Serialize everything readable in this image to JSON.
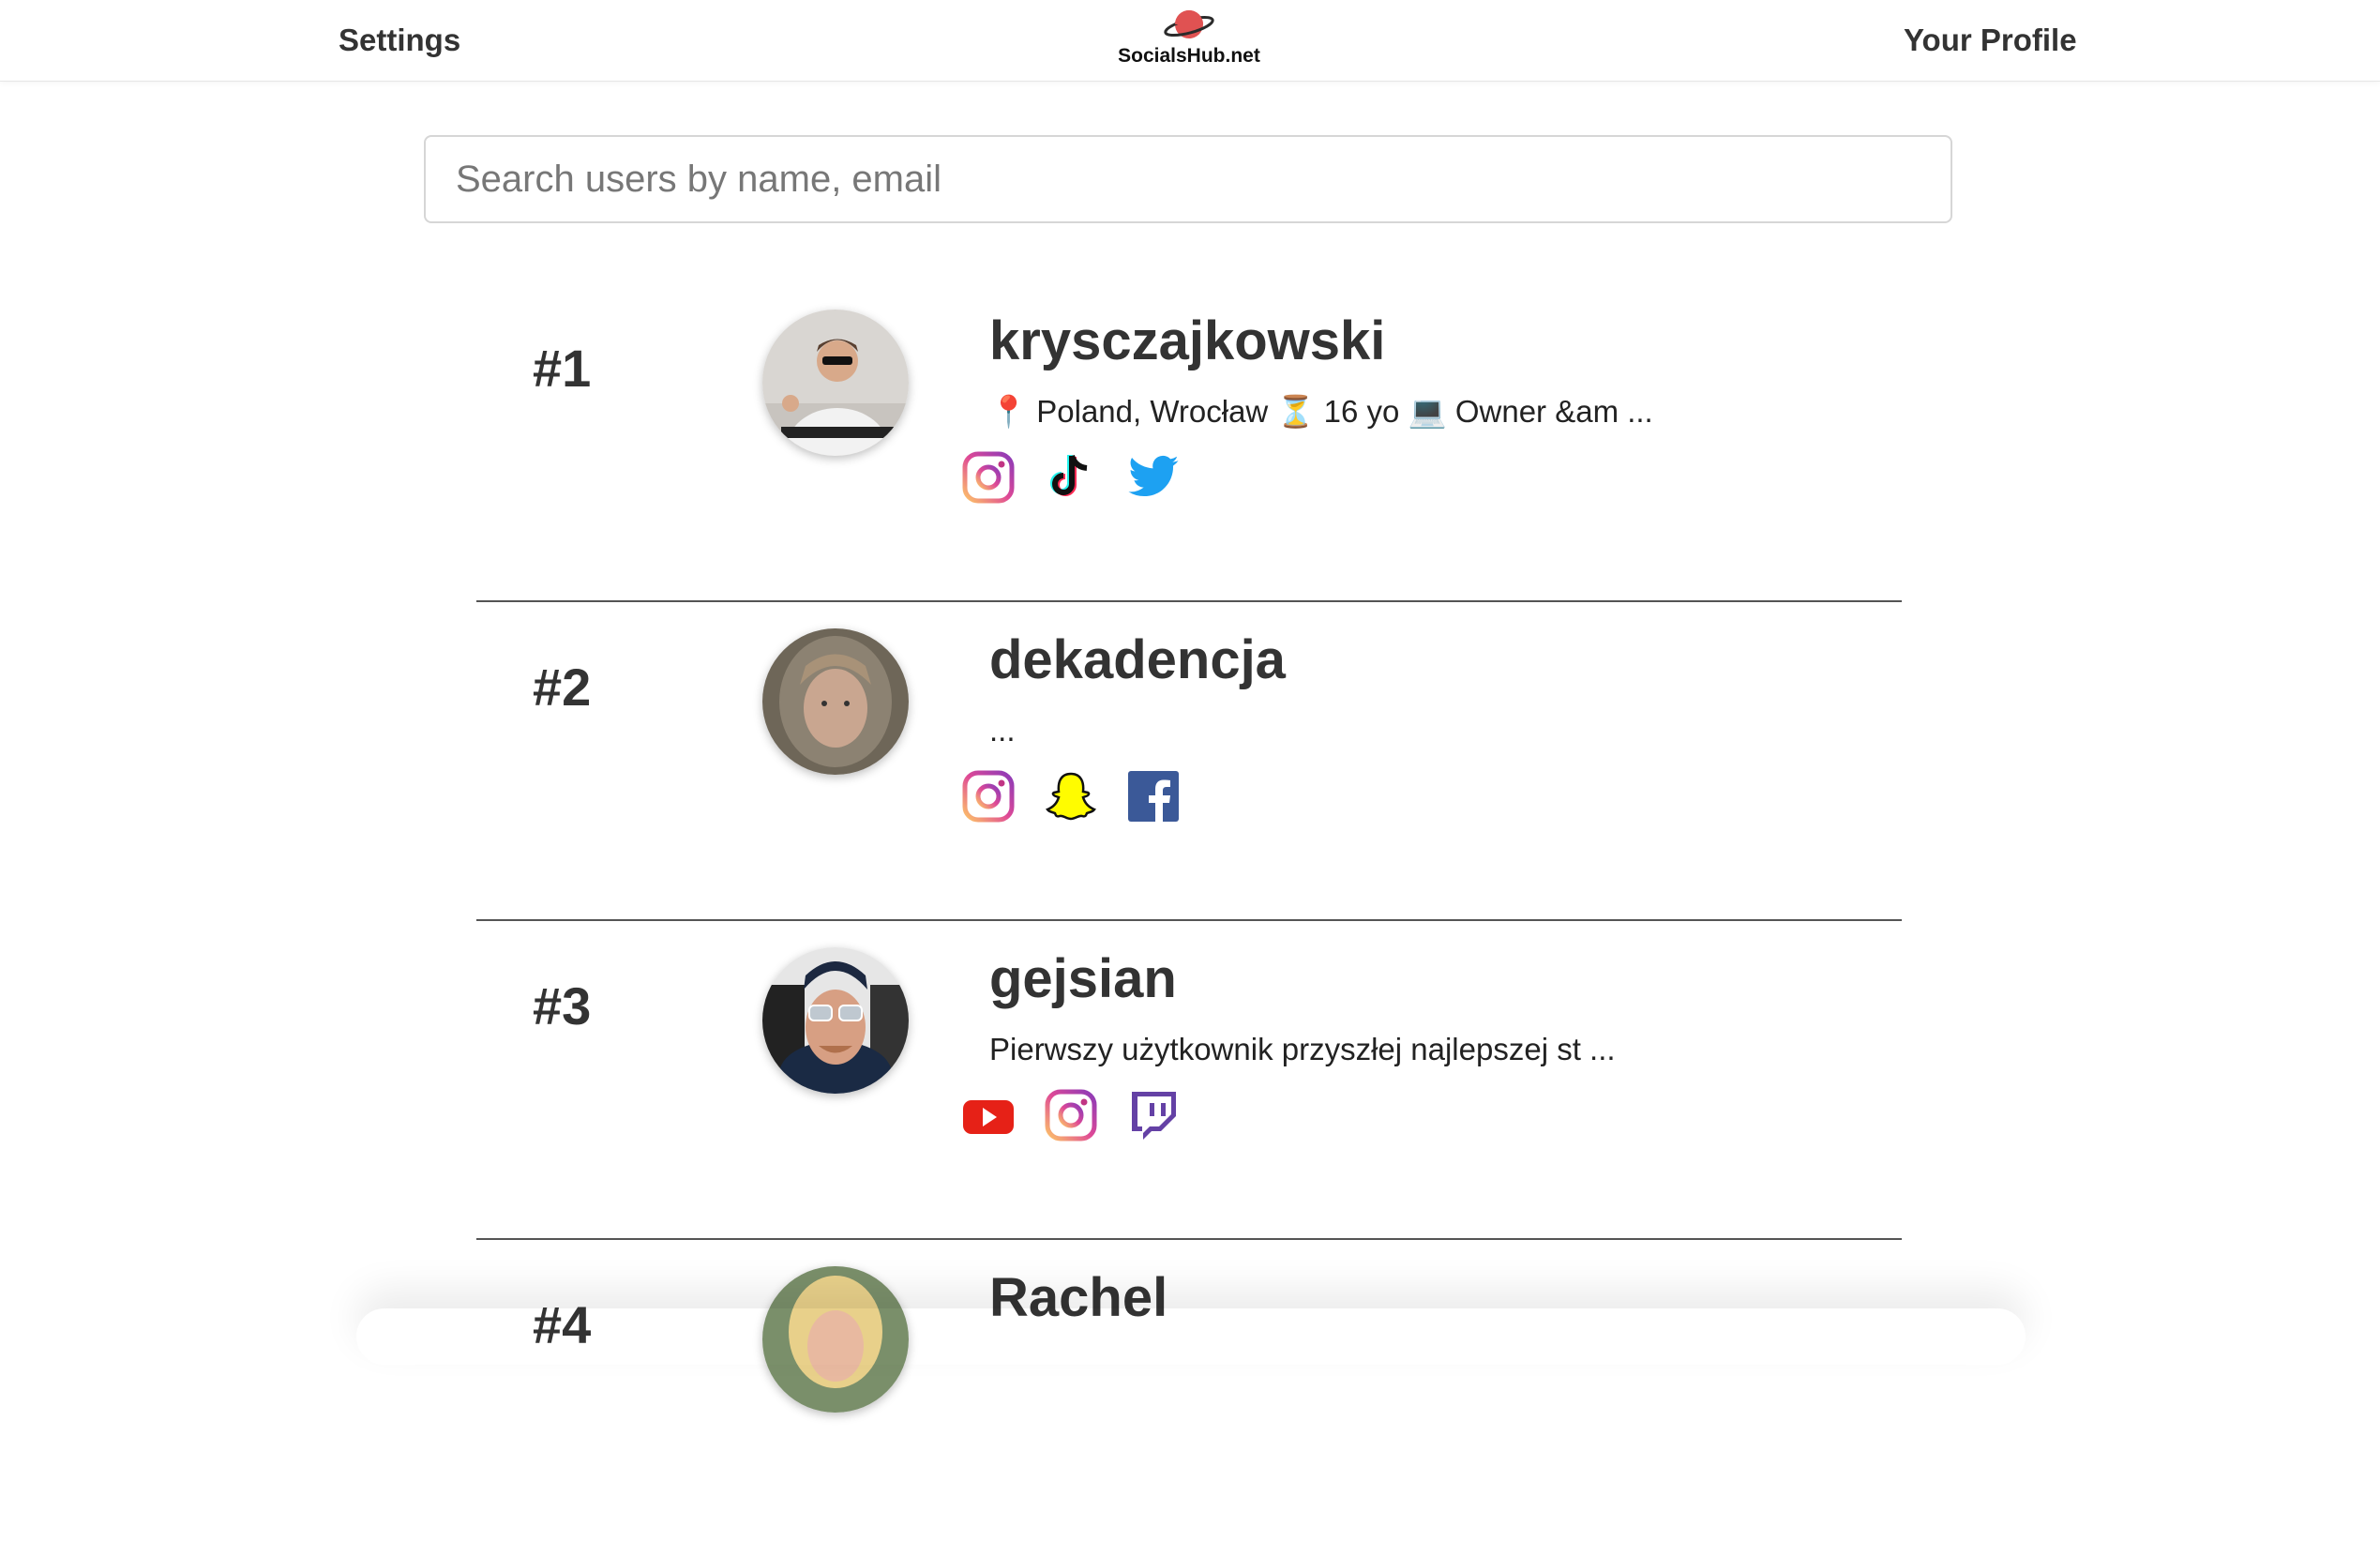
{
  "header": {
    "settings_label": "Settings",
    "logo_text": "SocialsHub.net",
    "profile_label": "Your Profile"
  },
  "search": {
    "placeholder": "Search users by name, email"
  },
  "users": [
    {
      "rank": "#1",
      "username": "krysczajkowski",
      "bio": "📍 Poland, Wrocław ⏳ 16 yo 💻 Owner &am ...",
      "socials": [
        "instagram-icon",
        "tiktok-icon",
        "twitter-icon"
      ]
    },
    {
      "rank": "#2",
      "username": "dekadencja",
      "bio": "...",
      "socials": [
        "instagram-icon",
        "snapchat-icon",
        "facebook-icon"
      ]
    },
    {
      "rank": "#3",
      "username": "gejsian",
      "bio": "Pierwszy użytkownik przyszłej najlepszej st ...",
      "socials": [
        "youtube-icon",
        "instagram-icon",
        "twitch-icon"
      ]
    },
    {
      "rank": "#4",
      "username": "Rachel",
      "bio": "",
      "socials": []
    }
  ],
  "colors": {
    "logo_planet": "#e05252",
    "instagram_gradient": [
      "#fdc468",
      "#df4996",
      "#8a3ab9"
    ],
    "twitter": "#1da1f2",
    "facebook": "#3b5998",
    "snapchat": "#fffc00",
    "youtube": "#e62117",
    "twitch": "#6441a5"
  }
}
